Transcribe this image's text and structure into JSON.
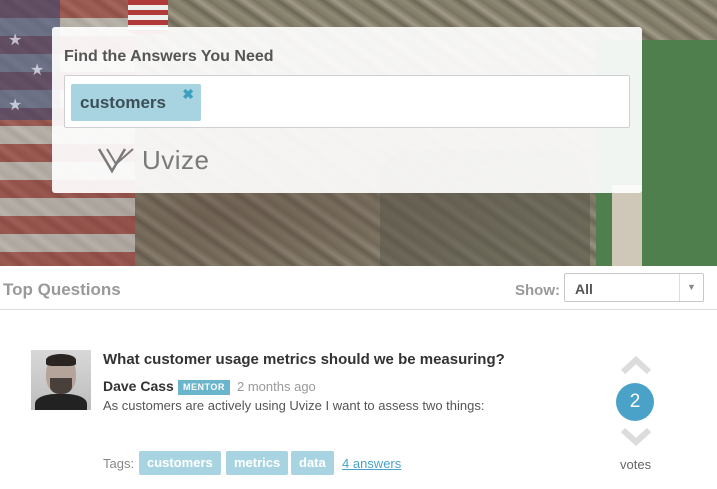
{
  "search": {
    "title": "Find the Answers You Need",
    "token": "customers",
    "token_close": "✖"
  },
  "logo": {
    "text": "Uvize"
  },
  "top_questions": {
    "title": "Top Questions",
    "show_label": "Show:",
    "show_value": "All",
    "arrow": "▼"
  },
  "question": {
    "title": "What customer usage metrics should we be measuring?",
    "author": "Dave Cass",
    "badge": "MENTOR",
    "time": "2 months ago",
    "excerpt": "As customers are actively using Uvize I want to assess two things:",
    "tags_label": "Tags:",
    "tags": [
      "customers",
      "metrics",
      "data"
    ],
    "answers": "4 answers",
    "votes": "2",
    "votes_label": "votes"
  },
  "colors": {
    "accent": "#4aa2c8",
    "tag_bg": "#a8d4e2",
    "badge": "#6bb5cc"
  }
}
